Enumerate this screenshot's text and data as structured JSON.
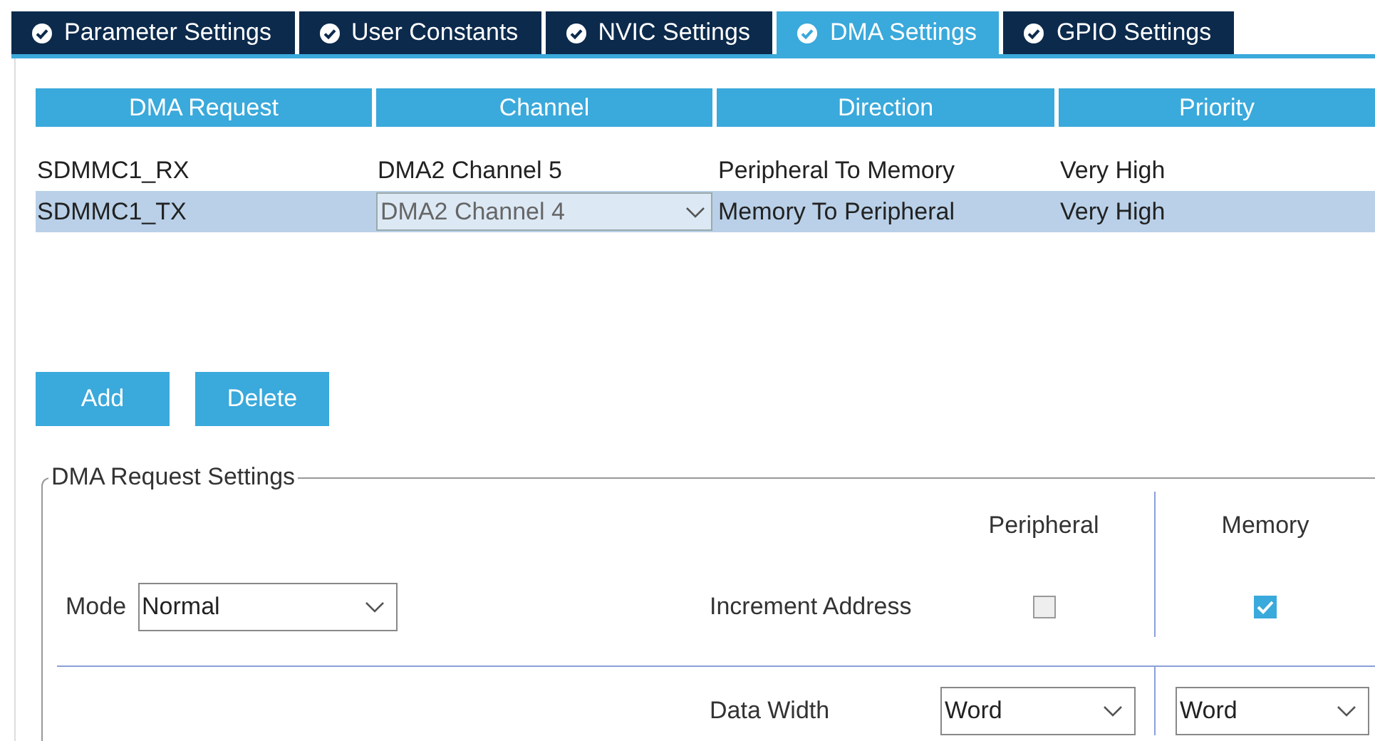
{
  "tabs": [
    {
      "label": "Parameter Settings",
      "selected": false
    },
    {
      "label": "User Constants",
      "selected": false
    },
    {
      "label": "NVIC Settings",
      "selected": false
    },
    {
      "label": "DMA Settings",
      "selected": true
    },
    {
      "label": "GPIO Settings",
      "selected": false
    }
  ],
  "table": {
    "columns": [
      "DMA Request",
      "Channel",
      "Direction",
      "Priority"
    ],
    "rows": [
      {
        "request": "SDMMC1_RX",
        "channel": "DMA2 Channel 5",
        "direction": "Peripheral To Memory",
        "priority": "Very High",
        "selected": false
      },
      {
        "request": "SDMMC1_TX",
        "channel": "DMA2 Channel 4",
        "direction": "Memory To Peripheral",
        "priority": "Very High",
        "selected": true
      }
    ]
  },
  "buttons": [
    "Add",
    "Delete"
  ],
  "settings": {
    "title": "DMA Request Settings",
    "mode_label": "Mode",
    "mode": "Normal",
    "columns": [
      "Peripheral",
      "Memory"
    ],
    "increment": {
      "label": "Increment Address",
      "peripheral_checked": false,
      "memory_checked": true
    },
    "data_width": {
      "label": "Data Width",
      "peripheral": "Word",
      "memory": "Word"
    }
  }
}
